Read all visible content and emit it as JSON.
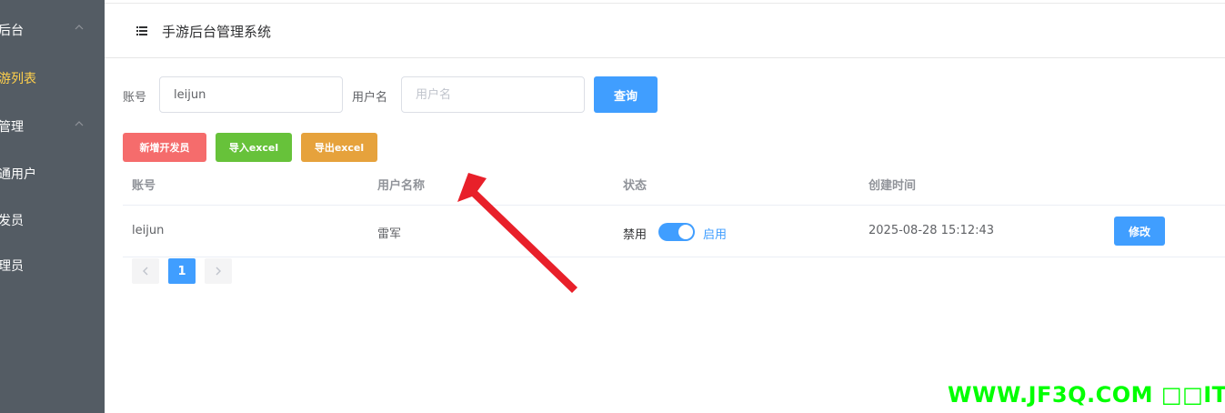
{
  "sidebar": {
    "items": [
      {
        "label": "后台",
        "chevron": true,
        "active": false
      },
      {
        "label": "游列表",
        "chevron": false,
        "active": true
      },
      {
        "label": "管理",
        "chevron": true,
        "active": false
      },
      {
        "label": "通用户",
        "chevron": false,
        "active": false
      },
      {
        "label": "发员",
        "chevron": false,
        "active": false
      },
      {
        "label": "理员",
        "chevron": false,
        "active": false
      }
    ]
  },
  "header": {
    "title": "手游后台管理系统",
    "menu_icon": "menu-fold-icon"
  },
  "search": {
    "account_label": "账号",
    "account_value": "leijun",
    "username_label": "用户名",
    "username_placeholder": "用户名",
    "query_label": "查询"
  },
  "actions": {
    "add_label": "新增开发员",
    "import_label": "导入excel",
    "export_label": "导出excel"
  },
  "table": {
    "columns": [
      "账号",
      "用户名称",
      "状态",
      "创建时间"
    ],
    "rows": [
      {
        "account": "leijun",
        "name": "雷军",
        "status_off": "禁用",
        "status_on": "启用",
        "enabled": true,
        "created": "2025-08-28 15:12:43",
        "edit_label": "修改"
      }
    ]
  },
  "pagination": {
    "current": "1",
    "prev_icon": "chevron-left-icon",
    "next_icon": "chevron-right-icon"
  },
  "watermark": "WWW.JF3Q.COM",
  "colors": {
    "primary": "#409eff",
    "danger": "#f56c6c",
    "success": "#67c23a",
    "warning": "#e6a23c",
    "sidebar": "#545c64",
    "active_menu": "#ffd04b",
    "annotation": "#e8202a"
  }
}
